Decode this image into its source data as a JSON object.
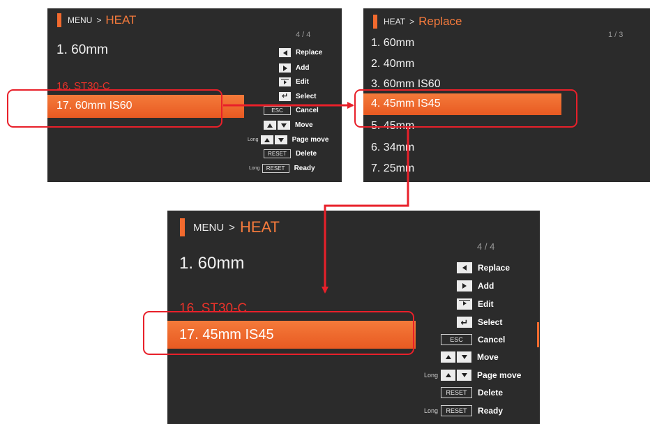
{
  "panel_menu_small": {
    "breadcrumb_parent": "MENU",
    "breadcrumb_sep": ">",
    "breadcrumb_current": "HEAT",
    "page_indicator": "4 / 4",
    "items": [
      "1. 60mm",
      "16. ST30-C",
      "17. 60mm IS60"
    ],
    "legend": {
      "replace": "Replace",
      "add": "Add",
      "edit": "Edit",
      "select": "Select",
      "esc_key": "ESC",
      "cancel": "Cancel",
      "move": "Move",
      "long": "Long",
      "page_move": "Page move",
      "reset_key": "RESET",
      "delete": "Delete",
      "ready": "Ready"
    }
  },
  "panel_replace": {
    "breadcrumb_parent": "HEAT",
    "breadcrumb_sep": ">",
    "breadcrumb_current": "Replace",
    "page_indicator": "1 / 3",
    "items": [
      "1. 60mm",
      "2. 40mm",
      "3. 60mm IS60",
      "4. 45mm IS45",
      "5. 45mm",
      "6. 34mm",
      "7. 25mm"
    ]
  },
  "panel_menu_large": {
    "breadcrumb_parent": "MENU",
    "breadcrumb_sep": ">",
    "breadcrumb_current": "HEAT",
    "page_indicator": "4 / 4",
    "items": [
      "1. 60mm",
      "16. ST30-C",
      "17. 45mm IS45"
    ],
    "legend": {
      "replace": "Replace",
      "add": "Add",
      "edit": "Edit",
      "select": "Select",
      "esc_key": "ESC",
      "cancel": "Cancel",
      "move": "Move",
      "long": "Long",
      "page_move": "Page move",
      "reset_key": "RESET",
      "delete": "Delete",
      "ready": "Ready"
    }
  },
  "colors": {
    "accent": "#f26a2e",
    "highlight_text_red": "#e8332a",
    "callout_red": "#e8202a",
    "screen_background": "#2b2b2b"
  }
}
